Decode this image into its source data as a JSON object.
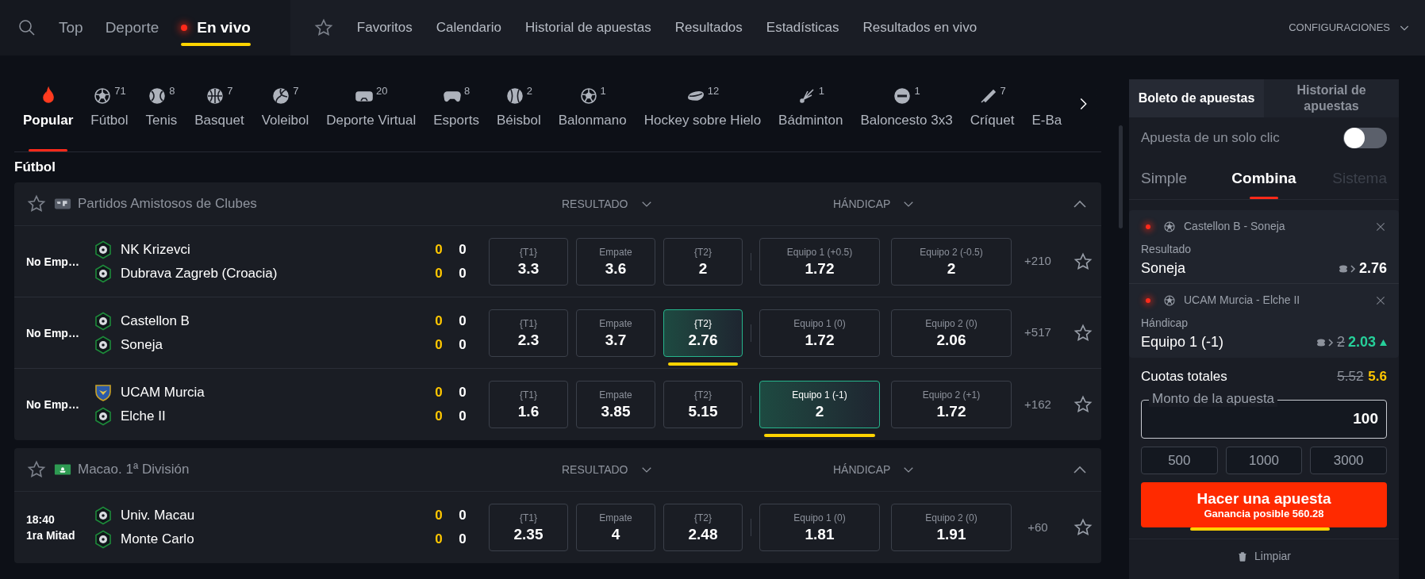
{
  "nav": {
    "items": [
      {
        "label": "Top",
        "selected": false,
        "live": false
      },
      {
        "label": "Deporte",
        "selected": false,
        "live": false
      },
      {
        "label": "En vivo",
        "selected": true,
        "live": true
      }
    ],
    "links": [
      "Favoritos",
      "Calendario",
      "Historial de apuestas",
      "Resultados",
      "Estadísticas",
      "Resultados en vivo"
    ],
    "settings": "CONFIGURACIONES"
  },
  "sports": [
    {
      "label": "Popular",
      "selected": true
    },
    {
      "label": "Fútbol",
      "count": "71",
      "selected": false
    },
    {
      "label": "Tenis",
      "count": "8",
      "selected": false
    },
    {
      "label": "Basquet",
      "count": "7",
      "selected": false
    },
    {
      "label": "Voleibol",
      "count": "7",
      "selected": false
    },
    {
      "label": "Deporte Virtual",
      "count": "20",
      "selected": false
    },
    {
      "label": "Esports",
      "count": "8",
      "selected": false
    },
    {
      "label": "Béisbol",
      "count": "2",
      "selected": false
    },
    {
      "label": "Balonmano",
      "count": "1",
      "selected": false
    },
    {
      "label": "Hockey sobre Hielo",
      "count": "12",
      "selected": false
    },
    {
      "label": "Bádminton",
      "count": "1",
      "selected": false
    },
    {
      "label": "Baloncesto 3x3",
      "count": "1",
      "selected": false
    },
    {
      "label": "Críquet",
      "count": "7",
      "selected": false
    },
    {
      "label": "E-Ba",
      "selected": false
    }
  ],
  "section_title": "Fútbol",
  "leagues": [
    {
      "name": "Partidos Amistosos de Clubes",
      "kind": "map",
      "markets": [
        "RESULTADO",
        "HÁNDICAP"
      ],
      "expanded": true,
      "matches": [
        {
          "time": [
            "No Emp…"
          ],
          "teams": [
            {
              "name": "NK Krizevci",
              "kind": "ball",
              "score_1": "0",
              "score_2": "0"
            },
            {
              "name": "Dubrava Zagreb (Croacia)",
              "kind": "ball",
              "score_1": "0",
              "score_2": "0"
            }
          ],
          "odds": [
            {
              "label": "{T1}",
              "value": "3.3",
              "selected": false
            },
            {
              "label": "Empate",
              "value": "3.6",
              "selected": false
            },
            {
              "label": "{T2}",
              "value": "2",
              "selected": false
            }
          ],
          "handicap": [
            {
              "label": "Equipo 1 (+0.5)",
              "value": "1.72",
              "selected": false
            },
            {
              "label": "Equipo 2 (-0.5)",
              "value": "2",
              "selected": false
            }
          ],
          "more": "+210"
        },
        {
          "time": [
            "No Emp…"
          ],
          "teams": [
            {
              "name": "Castellon B",
              "kind": "ball",
              "score_1": "0",
              "score_2": "0"
            },
            {
              "name": "Soneja",
              "kind": "ball",
              "score_1": "0",
              "score_2": "0"
            }
          ],
          "odds": [
            {
              "label": "{T1}",
              "value": "2.3",
              "selected": false
            },
            {
              "label": "Empate",
              "value": "3.7",
              "selected": false
            },
            {
              "label": "{T2}",
              "value": "2.76",
              "selected": true
            }
          ],
          "handicap": [
            {
              "label": "Equipo 1 (0)",
              "value": "1.72",
              "selected": false
            },
            {
              "label": "Equipo 2 (0)",
              "value": "2.06",
              "selected": false
            }
          ],
          "more": "+517"
        },
        {
          "time": [
            "No Emp…"
          ],
          "teams": [
            {
              "name": "UCAM Murcia",
              "kind": "crest",
              "score_1": "0",
              "score_2": "0"
            },
            {
              "name": "Elche II",
              "kind": "ball",
              "score_1": "0",
              "score_2": "0"
            }
          ],
          "odds": [
            {
              "label": "{T1}",
              "value": "1.6",
              "selected": false
            },
            {
              "label": "Empate",
              "value": "3.85",
              "selected": false
            },
            {
              "label": "{T2}",
              "value": "5.15",
              "selected": false
            }
          ],
          "handicap": [
            {
              "label": "Equipo 1 (-1)",
              "value": "2",
              "selected": true
            },
            {
              "label": "Equipo 2 (+1)",
              "value": "1.72",
              "selected": false
            }
          ],
          "more": "+162"
        }
      ]
    },
    {
      "name": "Macao. 1ª División",
      "kind": "flag",
      "markets": [
        "RESULTADO",
        "HÁNDICAP"
      ],
      "expanded": true,
      "matches": [
        {
          "time": [
            "18:40",
            "1ra Mitad"
          ],
          "teams": [
            {
              "name": "Univ. Macau",
              "kind": "ball",
              "score_1": "0",
              "score_2": "0"
            },
            {
              "name": "Monte Carlo",
              "kind": "ball",
              "score_1": "0",
              "score_2": "0"
            }
          ],
          "odds": [
            {
              "label": "{T1}",
              "value": "2.35",
              "selected": false
            },
            {
              "label": "Empate",
              "value": "4",
              "selected": false
            },
            {
              "label": "{T2}",
              "value": "2.48",
              "selected": false
            }
          ],
          "handicap": [
            {
              "label": "Equipo 1 (0)",
              "value": "1.81",
              "selected": false
            },
            {
              "label": "Equipo 2 (0)",
              "value": "1.91",
              "selected": false
            }
          ],
          "more": "+60"
        }
      ]
    }
  ],
  "slip": {
    "tabs": [
      {
        "label": "Boleto de apuestas",
        "selected": true
      },
      {
        "label": "Historial de apuestas",
        "selected": false
      }
    ],
    "one_click": {
      "label": "Apuesta de un solo clic",
      "on": false
    },
    "modes": [
      {
        "label": "Simple",
        "selected": false,
        "disabled": false
      },
      {
        "label": "Combina",
        "selected": true,
        "disabled": false
      },
      {
        "label": "Sistema",
        "selected": false,
        "disabled": true
      }
    ],
    "bets": [
      {
        "live": true,
        "match": "Castellon B - Soneja",
        "market": "Resultado",
        "pick": "Soneja",
        "odds": "2.76",
        "odds_up": false
      },
      {
        "live": true,
        "match": "UCAM Murcia - Elche II",
        "market": "Hándicap",
        "pick": "Equipo 1 (-1)",
        "old_odds": "2",
        "odds": "2.03",
        "odds_up": true
      }
    ],
    "totals": {
      "label": "Cuotas totales",
      "old": "5.52",
      "value": "5.6"
    },
    "stake": {
      "label": "Monto de la apuesta",
      "value": "100"
    },
    "quick": [
      "500",
      "1000",
      "3000"
    ],
    "place": {
      "label": "Hacer una apuesta",
      "subtitle": "Ganancia posible 560.28"
    },
    "clear": "Limpiar"
  }
}
